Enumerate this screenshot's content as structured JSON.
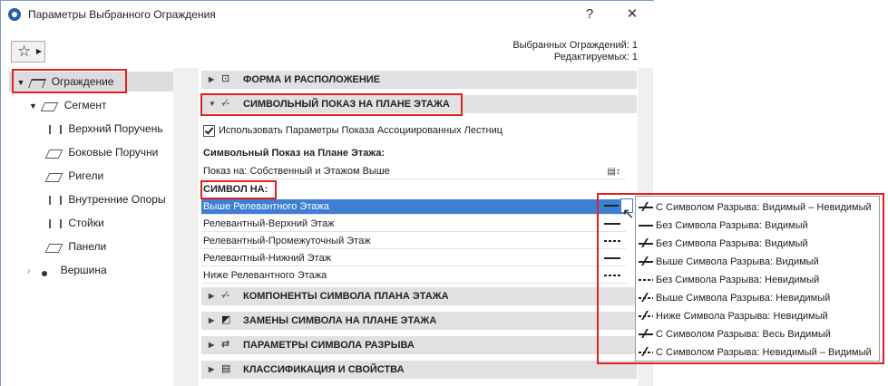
{
  "window": {
    "title": "Параметры Выбранного Ограждения",
    "help_label": "?",
    "close_label": "✕"
  },
  "favorites": {
    "icon": "star-icon"
  },
  "counts": {
    "selected": "Выбранных Ограждений: 1",
    "editable": "Редактируемых: 1"
  },
  "tree": {
    "root": "Ограждение",
    "segment": "Сегмент",
    "children": [
      "Верхний Поручень",
      "Боковые Поручни",
      "Ригели",
      "Внутренние Опоры",
      "Стойки",
      "Панели"
    ],
    "vertex": "Вершина"
  },
  "sections": {
    "form": "ФОРМА И РАСПОЛОЖЕНИЕ",
    "symbolic": "СИМВОЛЬНЫЙ ПОКАЗ НА ПЛАНЕ ЭТАЖА",
    "components": "КОМПОНЕНТЫ СИМВОЛА ПЛАНА ЭТАЖА",
    "overrides": "ЗАМЕНЫ СИМВОЛА НА ПЛАНЕ ЭТАЖА",
    "breakparams": "ПАРАМЕТРЫ СИМВОЛА РАЗРЫВА",
    "classification": "КЛАССИФИКАЦИЯ И СВОЙСТВА"
  },
  "symbolic": {
    "checkbox_label": "Использовать Параметры Показа Ассоциированных Лестниц",
    "checked": true,
    "display_heading": "Символьный Показ на Плане Этажа:",
    "show_on": "Показ на: Собственный и Этажом Выше",
    "symbol_on_heading": "СИМВОЛ НА:",
    "rows": [
      "Выше Релевантного Этажа",
      "Релевантный-Верхний Этаж",
      "Релевантный-Промежуточный Этаж",
      "Релевантный-Нижний Этаж",
      "Ниже Релевантного Этажа"
    ]
  },
  "dropdown": {
    "items": [
      {
        "label": "С Символом Разрыва: Видимый – Невидимый",
        "icon": "break-visible-invisible-icon"
      },
      {
        "label": "Без Символа Разрыва: Видимый",
        "icon": "solid-line-icon"
      },
      {
        "label": "Без Символа Разрыва: Видимый",
        "icon": "break-solid-icon"
      },
      {
        "label": "Выше Символа Разрыва: Видимый",
        "icon": "above-break-visible-icon"
      },
      {
        "label": "Без Символа Разрыва: Невидимый",
        "icon": "dashed-line-icon"
      },
      {
        "label": "Выше Символа Разрыва: Невидимый",
        "icon": "above-break-invisible-icon"
      },
      {
        "label": "Ниже Символа Разрыва: Невидимый",
        "icon": "below-break-invisible-icon"
      },
      {
        "label": "С Символом Разрыва: Весь Видимый",
        "icon": "break-all-visible-icon"
      },
      {
        "label": "С Символом Разрыва: Невидимый – Видимый",
        "icon": "break-invisible-visible-icon"
      }
    ]
  },
  "colors": {
    "highlight": "#e0211f",
    "selection": "#3d7fd2",
    "section_bg": "#e1e1e1"
  }
}
